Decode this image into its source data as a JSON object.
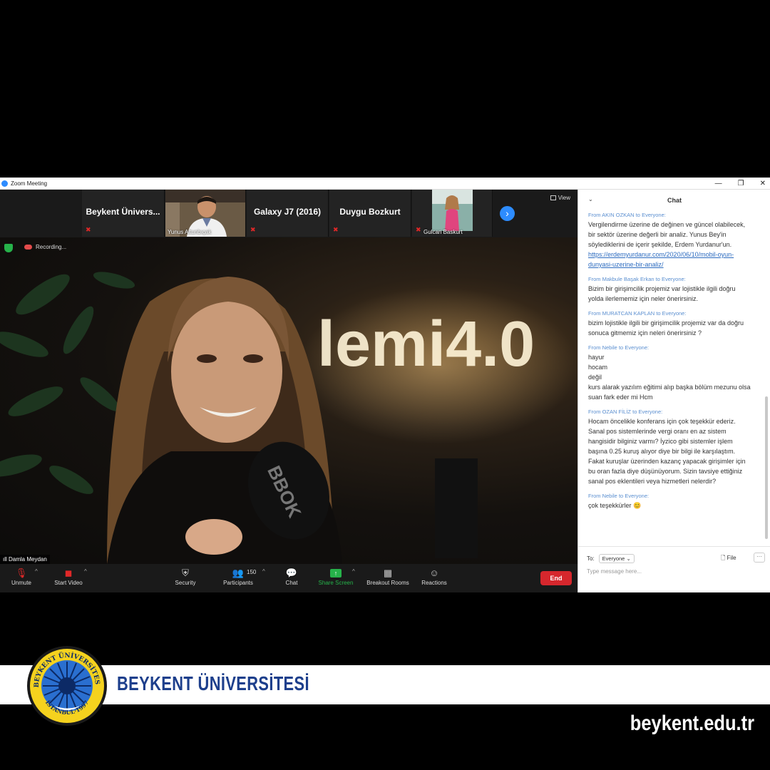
{
  "window": {
    "title": "Zoom Meeting",
    "controls": [
      "—",
      "❐",
      "✕"
    ]
  },
  "thumbnails": [
    {
      "name": "Beykent Ünivers...",
      "muted": true
    },
    {
      "label": "Yunus Altunbıçak",
      "muted": false
    },
    {
      "name": "Galaxy J7 (2016)",
      "muted": true
    },
    {
      "name": "Duygu Bozkurt",
      "muted": true
    },
    {
      "label": "Gulcan Baskurt",
      "muted": true
    }
  ],
  "view_label": "View",
  "recording_label": "Recording...",
  "speaker_name": "Damla Meydan",
  "toolbar": {
    "unmute": "Unmute",
    "start_video": "Start Video",
    "security": "Security",
    "participants": "Participants",
    "participants_count": "150",
    "chat": "Chat",
    "share_screen": "Share Screen",
    "breakout_rooms": "Breakout Rooms",
    "reactions": "Reactions",
    "end": "End"
  },
  "chat": {
    "title": "Chat",
    "messages": [
      {
        "from": "From",
        "sender": "AKIN OZKAN",
        "to": "to",
        "recipient": "Everyone:",
        "text": "Vergilendirme üzerine de değinen ve güncel olabilecek, bir sektör üzerine değerli bir analiz. Yunus Bey'in söylediklerini de içerir şekilde, Erdem Yurdanur'un.",
        "link": "https://erdemyurdanur.com/2020/06/10/mobil-oyun-dunyasi-uzerine-bir-analiz/"
      },
      {
        "from": "From",
        "sender": "Makbule Başak Erkan",
        "to": "to",
        "recipient": "Everyone:",
        "text": "Bizim bir girişimcilik projemiz var lojistikle ilgili doğru yolda ilerlememiz için neler önerirsiniz."
      },
      {
        "from": "From",
        "sender": "MURATCAN KAPLAN",
        "to": "to",
        "recipient": "Everyone:",
        "text": "bizim lojistikle ilgili bir girişimcilik projemiz var da doğru sonuca gitmemiz için neleri önerirsiniz ?"
      },
      {
        "from": "From",
        "sender": "Nebile",
        "to": "to",
        "recipient": "Everyone:",
        "text": "hayur\nhocam\ndeğil\nkurs alarak  yazılım eğitimi alıp başka bölüm mezunu olsa suan fark eder mi Hcm"
      },
      {
        "from": "From",
        "sender": "OZAN FİLİZ",
        "to": "to",
        "recipient": "Everyone:",
        "text": "Hocam öncelikle konferans için çok teşekkür ederiz. Sanal pos sistemlerinde vergi oranı en az sistem hangisidir bilginiz varmı? İyzico gibi sistemler işlem başına 0.25 kuruş alıyor diye bir bilgi ile karşılaştım. Fakat kuruşlar üzerinden kazanç yapacak girişimler için bu oran fazla diye düşünüyorum. Sizin tavsiye ettiğiniz sanal pos eklentileri veya hizmetleri nelerdir?"
      },
      {
        "from": "From",
        "sender": "Nebile",
        "to": "to",
        "recipient": "Everyone:",
        "text": "çok teşekkürler 😊"
      }
    ],
    "to_label": "To:",
    "to_value": "Everyone",
    "file_label": "File",
    "more_label": "···",
    "placeholder": "Type message here..."
  },
  "branding": {
    "university": "BEYKENT ÜNİVERSİTESİ",
    "seal_top": "BEYKENT ÜNİVERSİTESİ",
    "seal_bottom": "İSTANBUL·1997",
    "website": "beykent.edu.tr"
  },
  "colors": {
    "zoom_blue": "#2d8cff",
    "end_red": "#d6272d",
    "share_green": "#26b24a",
    "brand_navy": "#1d3f8c",
    "seal_yellow": "#f5d21e"
  },
  "icons": [
    "microphone-muted-icon",
    "video-off-icon",
    "shield-icon",
    "participants-icon",
    "chat-bubble-icon",
    "share-screen-arrow-icon",
    "breakout-grid-icon",
    "reaction-emoji-icon",
    "file-icon",
    "chevron-right-icon"
  ]
}
